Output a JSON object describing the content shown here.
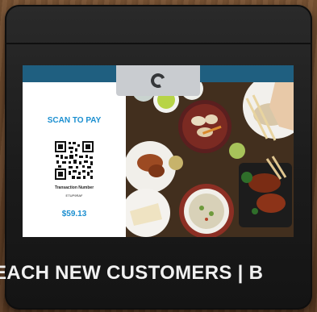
{
  "payment": {
    "title": "SCAN TO PAY",
    "transaction_label": "Transaction Number",
    "transaction_id": "ETUP9RAF",
    "amount": "$59.13"
  },
  "ticker": {
    "text": "EACH NEW CUSTOMERS  |  B"
  },
  "colors": {
    "accent": "#1b8fd0",
    "top_bar": "#1f5f80"
  },
  "icons": {
    "camera": "camera-icon",
    "qr": "qr-code-icon"
  }
}
